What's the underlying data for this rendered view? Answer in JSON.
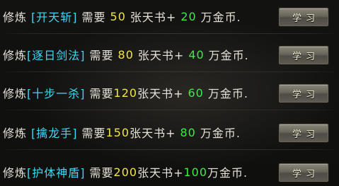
{
  "skills": [
    {
      "prefix": "修炼",
      "name": "[开天斩]",
      "need": "需要",
      "books": "50",
      "book_unit": "张天书+",
      "gold": "20",
      "gold_unit": "万金币.",
      "button": "学习"
    },
    {
      "prefix": "修炼",
      "name": "[逐日剑法]",
      "need": "需要",
      "books": "80",
      "book_unit": "张天书+",
      "gold": "40",
      "gold_unit": "万金币.",
      "button": "学习"
    },
    {
      "prefix": "修炼",
      "name": "[十步一杀]",
      "need": "需要",
      "books": "120",
      "book_unit": "张天书+",
      "gold": "60",
      "gold_unit": "万金币.",
      "button": "学习"
    },
    {
      "prefix": "修炼",
      "name": "[擒龙手]",
      "need": "需要",
      "books": "150",
      "book_unit": "张天书+",
      "gold": "80",
      "gold_unit": "万金币.",
      "button": "学习"
    },
    {
      "prefix": "修炼",
      "name": "[护体神盾]",
      "need": "需要",
      "books": "200",
      "book_unit": "张天书+",
      "gold": "100",
      "gold_unit": "万金币.",
      "button": "学习"
    }
  ],
  "colors": {
    "text": "#e6e2d8",
    "skill_name": "#3fd8f2",
    "book_count": "#f1e44a",
    "gold_count": "#42e84a",
    "button_text": "#f3ecd2"
  }
}
